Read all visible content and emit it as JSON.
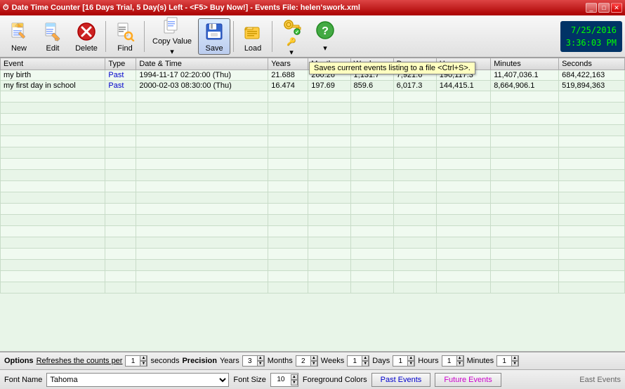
{
  "titleBar": {
    "title": "Date Time Counter [16 Days Trial, 5 Day(s) Left - <F5> Buy Now!] - Events File: helen'swork.xml"
  },
  "toolbar": {
    "new_label": "New",
    "edit_label": "Edit",
    "delete_label": "Delete",
    "find_label": "Find",
    "copy_value_label": "Copy Value",
    "save_label": "Save",
    "load_label": "Load",
    "date": "7/25/2016",
    "time": "3:36:03 PM",
    "tooltip": "Saves current events listing to a file <Ctrl+S>."
  },
  "table": {
    "columns": [
      "Event",
      "Type",
      "Date & Time",
      "Years",
      "Months",
      "Weeks",
      "Minutes",
      "Seconds"
    ],
    "rows": [
      {
        "event": "my birth",
        "type": "Past",
        "datetime": "1994-11-17 02:20:00 (Thu)",
        "years": "21.688",
        "months": "260.26",
        "weeks": "1,131.7",
        "days": "7,921.6",
        "hours": "190,117.3",
        "minutes": "11,407,036.1",
        "seconds": "684,422,163"
      },
      {
        "event": "my first day in school",
        "type": "Past",
        "datetime": "2000-02-03 08:30:00 (Thu)",
        "years": "16.474",
        "months": "197.69",
        "weeks": "859.6",
        "days": "6,017.3",
        "hours": "144,415.1",
        "minutes": "8,664,906.1",
        "seconds": "519,894,363"
      }
    ]
  },
  "options": {
    "label": "Options",
    "refresh_text": "Refreshes the counts per",
    "seconds_label": "seconds",
    "precision_label": "Precision",
    "years_label": "Years",
    "years_val": "3",
    "months_label": "Months",
    "months_val": "2",
    "weeks_label": "Weeks",
    "weeks_val": "1",
    "days_label": "Days",
    "days_val": "1",
    "hours_label": "Hours",
    "hours_val": "1",
    "minutes_label": "Minutes",
    "minutes_val": "1",
    "refresh_val": "1"
  },
  "fontBar": {
    "font_name_label": "Font Name",
    "font_value": "Tahoma",
    "font_size_label": "Font Size",
    "font_size_val": "10",
    "foreground_label": "Foreground Colors",
    "past_events_label": "Past Events",
    "future_events_label": "Future Events"
  },
  "statusBar": {
    "east_events_label": "East Events"
  }
}
